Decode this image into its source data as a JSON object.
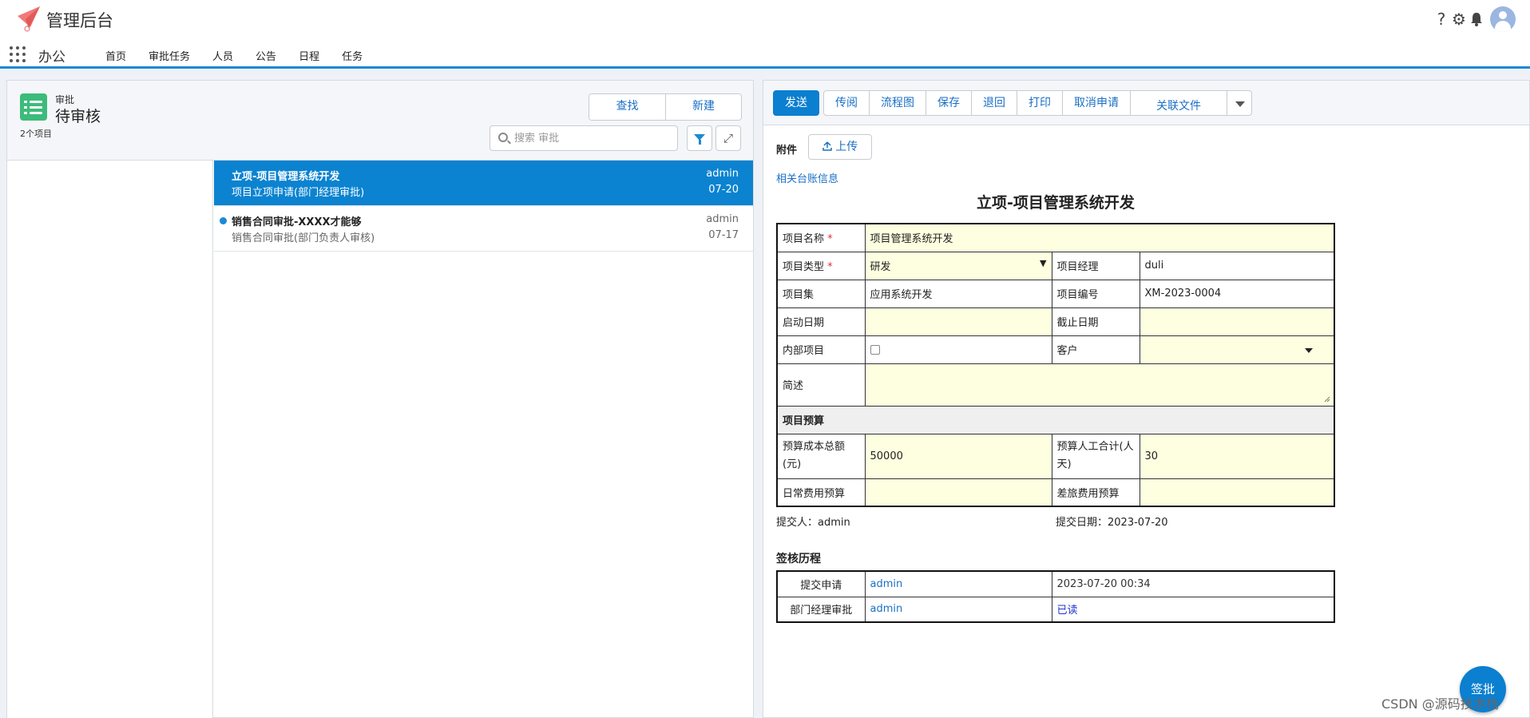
{
  "app": {
    "title": "管理后台",
    "name": "办公"
  },
  "nav": {
    "items": [
      "首页",
      "审批任务",
      "人员",
      "公告",
      "日程",
      "任务"
    ]
  },
  "left": {
    "subtitle": "审批",
    "title": "待审核",
    "count": "2个项目",
    "find_label": "查找",
    "new_label": "新建",
    "search_placeholder": "搜索 审批",
    "expand_glyph": "⤢",
    "items": [
      {
        "title": "立项-项目管理系统开发",
        "sub": "项目立项申请(部门经理审批)",
        "user": "admin",
        "date": "07-20"
      },
      {
        "title": "销售合同审批-XXXX才能够",
        "sub": "销售合同审批(部门负责人审核)",
        "user": "admin",
        "date": "07-17"
      }
    ]
  },
  "toolbar": {
    "send": "发送",
    "buttons": [
      "传阅",
      "流程图",
      "保存",
      "退回",
      "打印",
      "取消申请",
      "关联文件"
    ]
  },
  "form": {
    "attach_label": "附件",
    "upload_label": "上传",
    "related_link": "相关台账信息",
    "title": "立项-项目管理系统开发",
    "rows": {
      "name_label": "项目名称",
      "name_value": "项目管理系统开发",
      "type_label": "项目类型",
      "type_value": "研发",
      "manager_label": "项目经理",
      "manager_value": "duli",
      "set_label": "项目集",
      "set_value": "应用系统开发",
      "code_label": "项目编号",
      "code_value": "XM-2023-0004",
      "start_label": "启动日期",
      "end_label": "截止日期",
      "internal_label": "内部项目",
      "customer_label": "客户",
      "desc_label": "简述",
      "budget_section": "项目预算",
      "cost_label": "预算成本总额(元)",
      "cost_value": "50000",
      "labor_label": "预算人工合计(人天)",
      "labor_value": "30",
      "daily_label": "日常费用预算",
      "travel_label": "差旅费用预算"
    },
    "submitter": "提交人：admin",
    "submit_date": "提交日期：2023-07-20"
  },
  "history": {
    "title": "签核历程",
    "rows": [
      {
        "step": "提交申请",
        "user": "admin",
        "info": "2023-07-20 00:34"
      },
      {
        "step": "部门经理审批",
        "user": "admin",
        "info": "已读"
      }
    ]
  },
  "sign_label": "签批",
  "watermark": "CSDN @源码技术栈",
  "colors": {
    "accent": "#0b7fd0",
    "header_green": "#3dbb7b",
    "field_yellow": "#fefee0"
  }
}
